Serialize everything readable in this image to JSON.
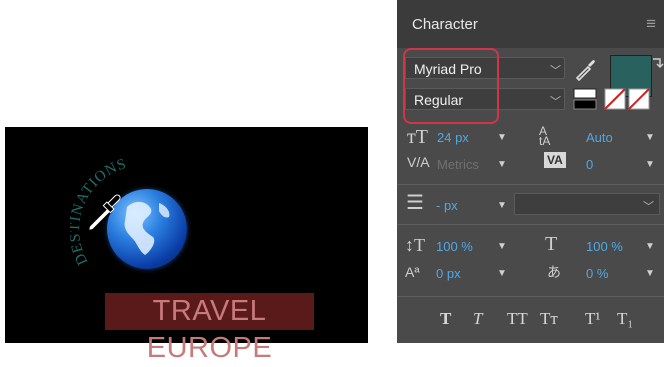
{
  "canvas": {
    "arc_text": "DESTINATIONS",
    "banner_text": "TRAVEL EUROPE"
  },
  "panel": {
    "title": "Character",
    "menu_icon": "hamburger-icon",
    "font_family": "Myriad Pro",
    "font_style": "Regular",
    "fill_color": "#29615e",
    "font_size": "24 px",
    "leading": "Auto",
    "kerning": "Metrics",
    "tracking": "0",
    "unit_value": "- px",
    "vertical_scale": "100 %",
    "horizontal_scale": "100 %",
    "baseline_shift": "0 px",
    "tsume": "0 %",
    "style_buttons": [
      "T",
      "T",
      "TT",
      "Tт",
      "T¹",
      "T₁"
    ]
  }
}
